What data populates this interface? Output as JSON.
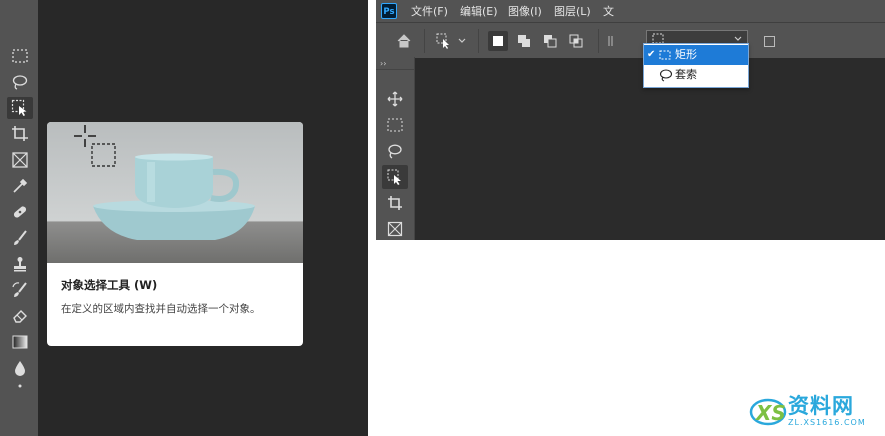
{
  "left_tooltip": {
    "title": "对象选择工具 (W)",
    "description": "在定义的区域内查找并自动选择一个对象。"
  },
  "left_tools": [
    "rectangular-marquee",
    "lasso",
    "object-selection",
    "crop",
    "frame",
    "eyedropper",
    "spot-healing",
    "brush",
    "clone-stamp",
    "history-brush",
    "eraser",
    "gradient",
    "blur"
  ],
  "menubar": {
    "logo": "Ps",
    "items": [
      "文件(F)",
      "编辑(E)",
      "图像(I)",
      "图层(L)",
      "文"
    ]
  },
  "mode_dropdown": {
    "options": [
      {
        "label": "矩形",
        "checked": true
      },
      {
        "label": "套索",
        "checked": false
      }
    ]
  },
  "watermark": {
    "text": "资料网",
    "url": "ZL.XS1616.COM"
  },
  "colors": {
    "accent": "#1e7bd7",
    "toolbar": "#535353",
    "canvas": "#282828"
  }
}
